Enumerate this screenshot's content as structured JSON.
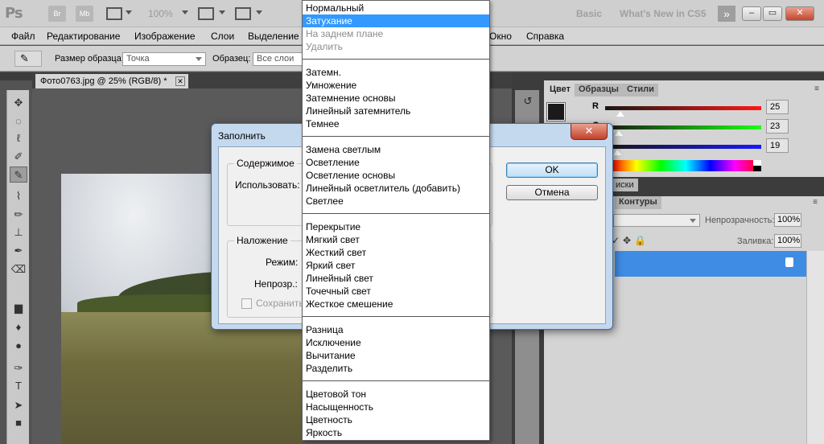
{
  "titlebar": {
    "logo": "Ps",
    "br_label": "Br",
    "mb_label": "Mb",
    "zoom": "100%",
    "workspace_basic": "Basic",
    "workspace_new": "What's New in CS5",
    "more_arrows": "»",
    "minimize": "–",
    "maximize": "▭",
    "close": "✕"
  },
  "menubar": {
    "items": [
      "Файл",
      "Редактирование",
      "Изображение",
      "Слои",
      "Выделение",
      "Окно",
      "Справка"
    ]
  },
  "options": {
    "sample_size_label": "Размер образца:",
    "sample_size_value": "Точка",
    "sample_label": "Образец:",
    "sample_value": "Все слои"
  },
  "document": {
    "tab_title": "Фото0763.jpg @ 25% (RGB/8) *",
    "close": "✕"
  },
  "panels": {
    "tabs": [
      "Цвет",
      "Образцы",
      "Стили"
    ],
    "menu_glyph": "≡",
    "sliders": [
      {
        "label": "R",
        "value": "25",
        "fraction": 0.1
      },
      {
        "label": "G",
        "value": "23",
        "fraction": 0.09
      },
      {
        "label": "B",
        "value": "19",
        "fraction": 0.075
      }
    ],
    "layers_tab_partial": "иски",
    "paths_tab": "Контуры",
    "opacity_label": "Непрозрачность:",
    "opacity_value": "100%",
    "fill_label": "Заливка:",
    "fill_value": "100%"
  },
  "dialog": {
    "title": "Заполнить",
    "close": "✕",
    "contents_group": "Содержимое",
    "use_label": "Использовать:",
    "blending_group": "Наложение",
    "mode_label": "Режим:",
    "opacity_label": "Непрозр.:",
    "preserve_label": "Сохранить п",
    "ok": "OK",
    "cancel": "Отмена"
  },
  "blend_menu": {
    "selected_index": 1,
    "groups": [
      [
        {
          "label": "Нормальный",
          "state": "normal"
        },
        {
          "label": "Затухание",
          "state": "selected"
        },
        {
          "label": "На заднем плане",
          "state": "disabled"
        },
        {
          "label": "Удалить",
          "state": "disabled"
        }
      ],
      [
        {
          "label": "Затемн.",
          "state": "normal"
        },
        {
          "label": "Умножение",
          "state": "normal"
        },
        {
          "label": "Затемнение основы",
          "state": "normal"
        },
        {
          "label": "Линейный затемнитель",
          "state": "normal"
        },
        {
          "label": "Темнее",
          "state": "normal"
        }
      ],
      [
        {
          "label": "Замена светлым",
          "state": "normal"
        },
        {
          "label": "Осветление",
          "state": "normal"
        },
        {
          "label": "Осветление основы",
          "state": "normal"
        },
        {
          "label": "Линейный осветлитель (добавить)",
          "state": "normal"
        },
        {
          "label": "Светлее",
          "state": "normal"
        }
      ],
      [
        {
          "label": "Перекрытие",
          "state": "normal"
        },
        {
          "label": "Мягкий свет",
          "state": "normal"
        },
        {
          "label": "Жесткий свет",
          "state": "normal"
        },
        {
          "label": "Яркий свет",
          "state": "normal"
        },
        {
          "label": "Линейный свет",
          "state": "normal"
        },
        {
          "label": "Точечный свет",
          "state": "normal"
        },
        {
          "label": "Жесткое смешение",
          "state": "normal"
        }
      ],
      [
        {
          "label": "Разница",
          "state": "normal"
        },
        {
          "label": "Исключение",
          "state": "normal"
        },
        {
          "label": "Вычитание",
          "state": "normal"
        },
        {
          "label": "Разделить",
          "state": "normal"
        }
      ],
      [
        {
          "label": "Цветовой тон",
          "state": "normal"
        },
        {
          "label": "Насыщенность",
          "state": "normal"
        },
        {
          "label": "Цветность",
          "state": "normal"
        },
        {
          "label": "Яркость",
          "state": "normal"
        }
      ]
    ]
  },
  "tools": [
    "move-tool-icon",
    "marquee-tool-icon",
    "lasso-tool-icon",
    "quick-selection-tool-icon",
    "eyedropper-tool-icon",
    "healing-brush-tool-icon",
    "brush-tool-icon",
    "clone-stamp-tool-icon",
    "history-brush-tool-icon",
    "eraser-tool-icon",
    "gradient-tool-icon",
    "blur-tool-icon",
    "dodge-tool-icon",
    "pen-tool-icon",
    "type-tool-icon",
    "path-selection-tool-icon",
    "rectangle-tool-icon"
  ],
  "colors": {
    "selection": "#3399ff",
    "layer_selected": "#3f8ce4",
    "dialog_frame": "#c4d8ee"
  }
}
